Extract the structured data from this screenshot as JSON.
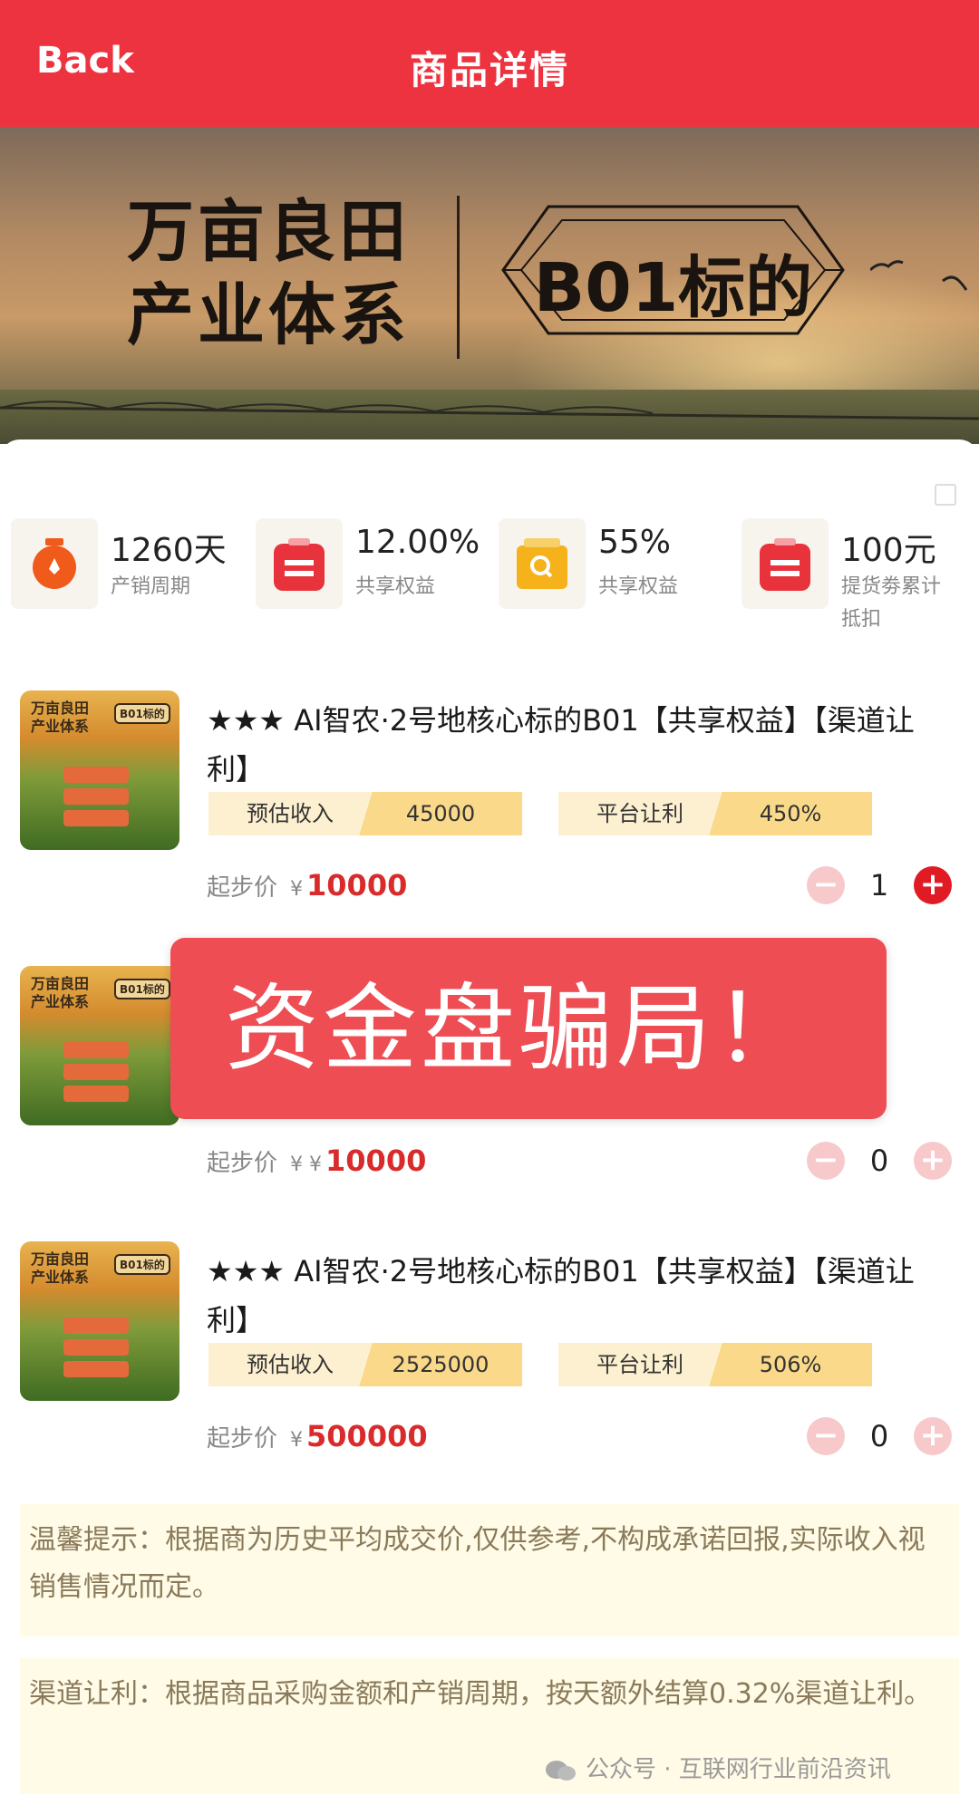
{
  "header": {
    "back_label": "Back",
    "title": "商品详情"
  },
  "banner": {
    "slogan_line1": "万亩良田",
    "slogan_line2": "产业体系",
    "tag": "B01标的"
  },
  "stats": [
    {
      "value": "1260天",
      "label": "产销周期",
      "icon": "clock-icon",
      "icon_color": "#f05a1a"
    },
    {
      "value": "12.00%",
      "label": "共享权益",
      "icon": "wallet-icon",
      "icon_color": "#e8323c"
    },
    {
      "value": "55%",
      "label": "共享权益",
      "icon": "search-box-icon",
      "icon_color": "#f5b21b"
    },
    {
      "value": "100元",
      "label": "提货劵累计抵扣",
      "icon": "wallet-icon",
      "icon_color": "#e8323c"
    }
  ],
  "products": [
    {
      "thumb_line1": "万亩良田",
      "thumb_line2": "产业体系",
      "thumb_tag": "B01标的",
      "name": "★★★ AI智农·2号地核心标的B01【共享权益】【渠道让利】",
      "income_label": "预估收入",
      "income_value": "45000",
      "rebate_label": "平台让利",
      "rebate_value": "450%",
      "price_label": "起步价",
      "currency": "¥",
      "price": "10000",
      "qty": "1",
      "minus": "−",
      "plus": "+"
    },
    {
      "thumb_line1": "万亩良田",
      "thumb_line2": "产业体系",
      "thumb_tag": "B01标的",
      "price_label": "起步价",
      "currency": "¥ ¥",
      "price": "10000",
      "qty": "0",
      "minus": "−",
      "plus": "+"
    },
    {
      "thumb_line1": "万亩良田",
      "thumb_line2": "产业体系",
      "thumb_tag": "B01标的",
      "name": "★★★ AI智农·2号地核心标的B01【共享权益】【渠道让利】",
      "income_label": "预估收入",
      "income_value": "2525000",
      "rebate_label": "平台让利",
      "rebate_value": "506%",
      "price_label": "起步价",
      "currency": "¥",
      "price": "500000",
      "qty": "0",
      "minus": "−",
      "plus": "+"
    }
  ],
  "overlay": {
    "text": "资金盘骗局！"
  },
  "notices": [
    "温馨提示：根据商为历史平均成交价,仅供参考,不构成承诺回报,实际收入视销售情况而定。",
    "渠道让利：根据商品采购金额和产销周期，按天额外结算0.32%渠道让利。"
  ],
  "watermark": "公众号 · 互联网行业前沿资讯"
}
